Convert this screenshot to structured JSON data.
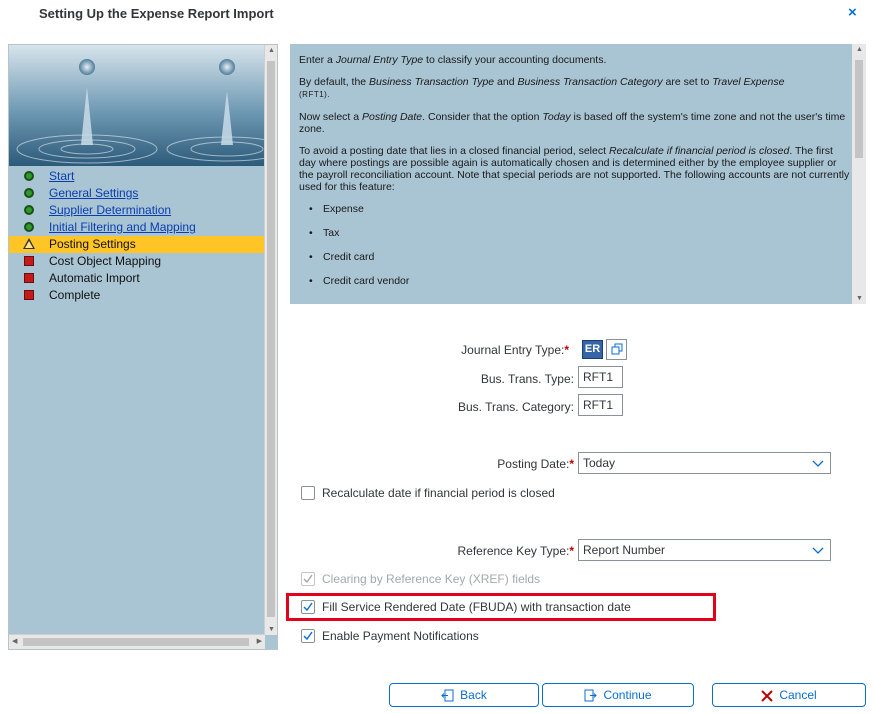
{
  "dialog": {
    "title": "Setting Up the Expense Report Import",
    "close_symbol": "×"
  },
  "nav": {
    "items": [
      {
        "label": "Start",
        "status": "done",
        "link": true
      },
      {
        "label": "General Settings",
        "status": "done",
        "link": true
      },
      {
        "label": "Supplier Determination",
        "status": "done",
        "link": true
      },
      {
        "label": "Initial Filtering and Mapping",
        "status": "done",
        "link": true
      },
      {
        "label": "Posting Settings",
        "status": "current",
        "link": false
      },
      {
        "label": "Cost Object Mapping",
        "status": "todo",
        "link": false
      },
      {
        "label": "Automatic Import",
        "status": "todo",
        "link": false
      },
      {
        "label": "Complete",
        "status": "todo",
        "link": false
      }
    ]
  },
  "info": {
    "p1_a": "Enter a ",
    "p1_b": "Journal Entry Type",
    "p1_c": " to classify your accounting documents.",
    "p2_a": "By default, the ",
    "p2_b": "Business Transaction Type",
    "p2_c": " and ",
    "p2_d": "Business Transaction Category",
    "p2_e": " are set to ",
    "p2_f": "Travel Expense",
    "p2_g": "(RFT1).",
    "p3_a": "Now select a ",
    "p3_b": "Posting Date",
    "p3_c": ". Consider that the option ",
    "p3_d": "Today",
    "p3_e": " is based off the system's time zone and not the user's time zone.",
    "p4_a": "To avoid a posting date that lies in a closed financial period, select ",
    "p4_b": "Recalculate if financial period is closed",
    "p4_c": ". The first day where postings are possible again is automatically chosen and is determined either by the employee supplier or the payroll reconciliation account. Note that special periods are not supported. The following accounts are not currently used for this feature:",
    "accounts": [
      "Expense",
      "Tax",
      "Credit card",
      "Credit card vendor"
    ]
  },
  "form": {
    "journal_entry_type_label": "Journal Entry Type:",
    "journal_entry_type_value": "ER",
    "bus_trans_type_label": "Bus. Trans. Type:",
    "bus_trans_type_value": "RFT1",
    "bus_trans_category_label": "Bus. Trans. Category:",
    "bus_trans_category_value": "RFT1",
    "posting_date_label": "Posting Date:",
    "posting_date_value": "Today",
    "recalculate_label": "Recalculate date if financial period is closed",
    "reference_key_type_label": "Reference Key Type:",
    "reference_key_type_value": "Report Number",
    "clearing_label": "Clearing by Reference Key (XREF) fields",
    "fill_service_label": "Fill Service Rendered Date (FBUDA) with transaction date",
    "enable_payment_label": "Enable Payment Notifications",
    "required_mark": "*"
  },
  "footer": {
    "back_label": "Back",
    "continue_label": "Continue",
    "cancel_label": "Cancel"
  },
  "colors": {
    "accent": "#0a6ed1",
    "panel_bg": "#a9c4d3",
    "active_step": "#ffc425",
    "highlight_border": "#e3001b",
    "cancel_icon": "#bb0000"
  }
}
